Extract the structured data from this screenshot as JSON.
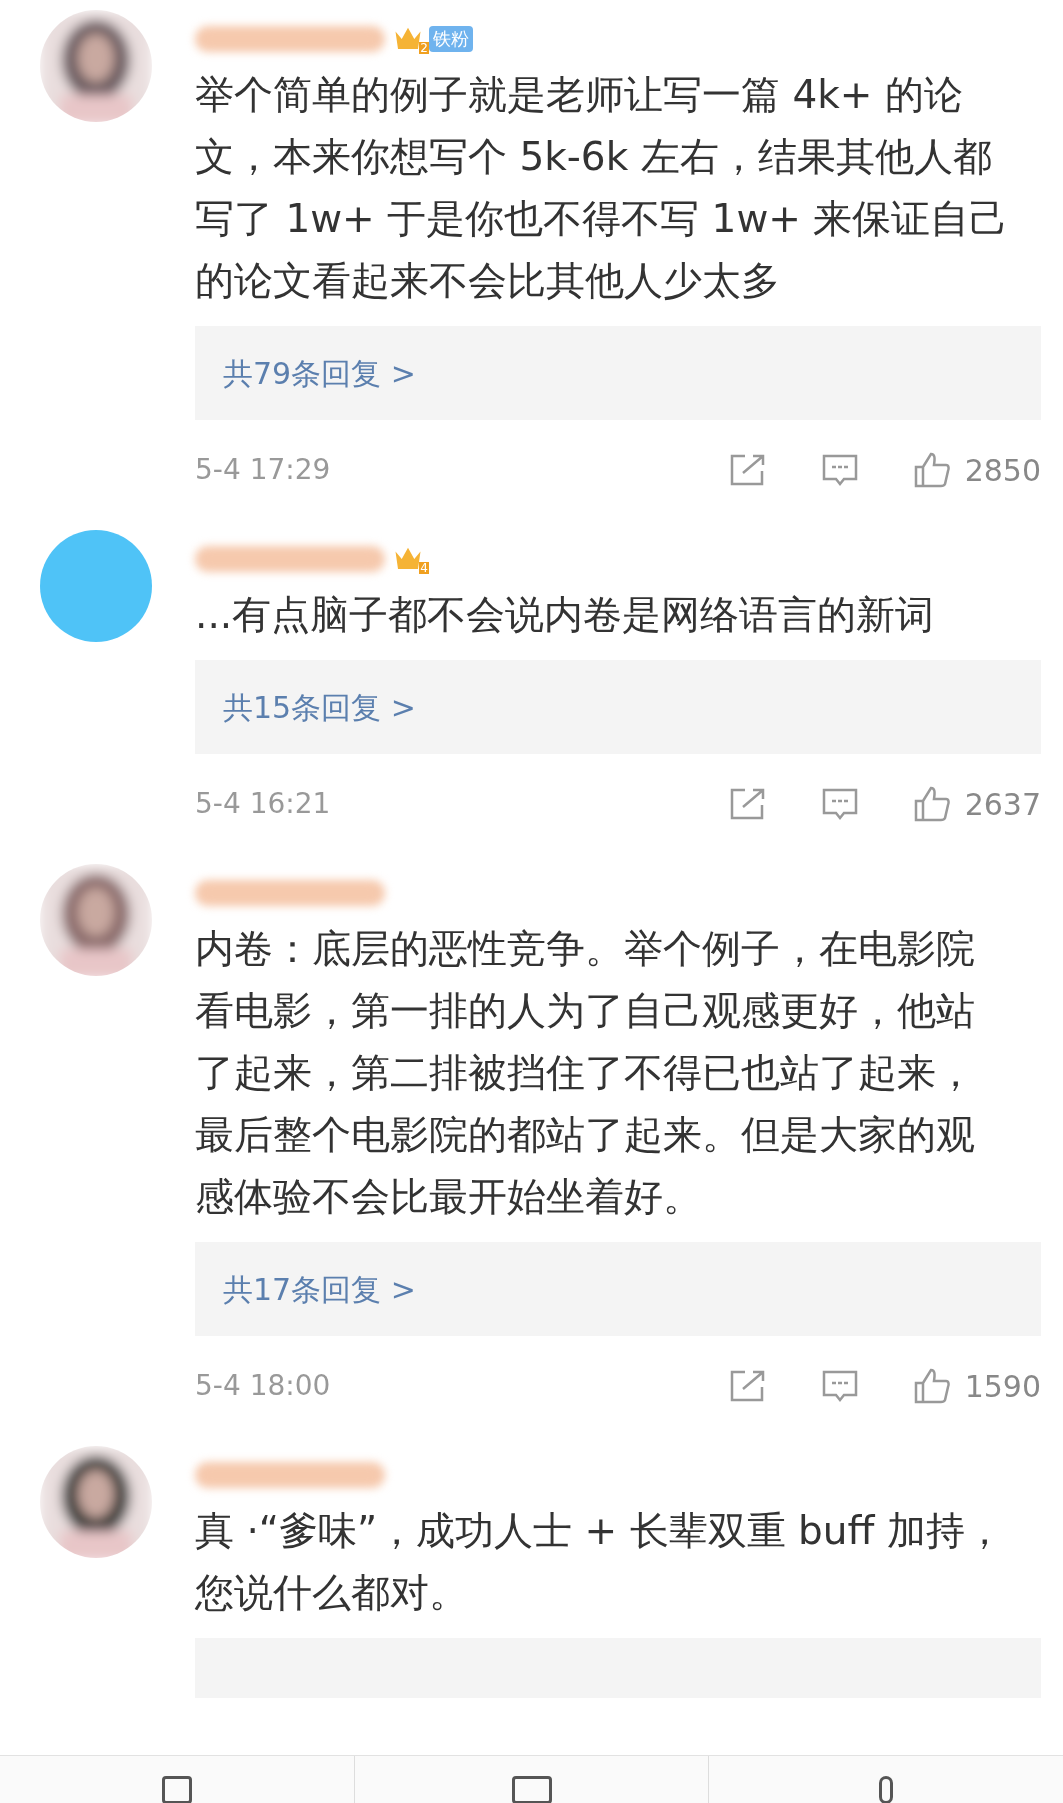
{
  "comments": [
    {
      "avatar": {
        "kind": "picture"
      },
      "badge": {
        "level": "2",
        "fan_label": "铁粉"
      },
      "text_lines": [
        "举个简单的例子就是老师让写一篇 4k+ 的论",
        "文，本来你想写个 5k-6k 左右，结果其他人都",
        "写了 1w+ 于是你也不得不写 1w+ 来保证自己",
        "的论文看起来不会比其他人少太多"
      ],
      "replies": "共79条回复 >",
      "time": "5-4 17:29",
      "likes": "2850"
    },
    {
      "avatar": {
        "kind": "plain"
      },
      "badge": {
        "level": "4"
      },
      "text_lines": [
        "...有点脑子都不会说内卷是网络语言的新词"
      ],
      "replies": "共15条回复 >",
      "time": "5-4 16:21",
      "likes": "2637"
    },
    {
      "avatar": {
        "kind": "picture"
      },
      "text_lines": [
        "内卷：底层的恶性竞争。举个例子，在电影院",
        "看电影，第一排的人为了自己观感更好，他站",
        "了起来，第二排被挡住了不得已也站了起来，",
        "最后整个电影院的都站了起来。但是大家的观",
        "感体验不会比最开始坐着好。"
      ],
      "replies": "共17条回复 >",
      "time": "5-4 18:00",
      "likes": "1590"
    },
    {
      "avatar": {
        "kind": "picture"
      },
      "text_lines": [
        "真 ·“爹味”，成功人士 + 长辈双重 buff 加持，",
        "您说什么都对。"
      ]
    }
  ]
}
